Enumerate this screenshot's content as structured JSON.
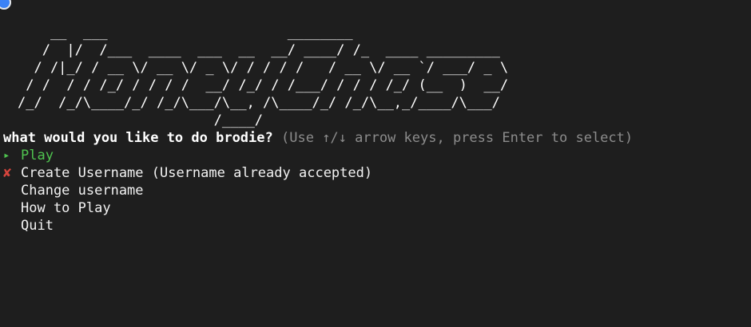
{
  "banner": {
    "ascii_lines": [
      "    __  ___                      ________",
      "   /  |/  /___  ____  ___  __  __/ ____/ /_  ____ _________",
      "  / /|_/ / __ \\/ __ \\/ _ \\/ / / / /   / __ \\/ __ `/ ___/ _ \\",
      " / /  / / /_/ / / / /  __/ /_/ / /___/ / / / /_/ (__  )  __/",
      "/_/  /_/\\____/_/ /_/\\___/\\__, /\\____/_/ /_/\\__,_/____/\\___/",
      "                        /____/"
    ]
  },
  "prompt": {
    "question": "what would you like to do brodie?",
    "hint": "(Use ↑/↓ arrow keys, press Enter to select)"
  },
  "menu": {
    "items": [
      {
        "marker": "▸",
        "label": "Play",
        "state": "selected"
      },
      {
        "marker": "✘",
        "label": "Create Username (Username already accepted)",
        "state": "disabled"
      },
      {
        "marker": "",
        "label": "Change username",
        "state": "normal"
      },
      {
        "marker": "",
        "label": "How to Play",
        "state": "normal"
      },
      {
        "marker": "",
        "label": "Quit",
        "state": "normal"
      }
    ]
  },
  "colors": {
    "background": "#1e1e1e",
    "text": "#f2f2f2",
    "hint": "#8c8c8c",
    "selected": "#4fc34f",
    "disabled_marker": "#d6453d"
  }
}
